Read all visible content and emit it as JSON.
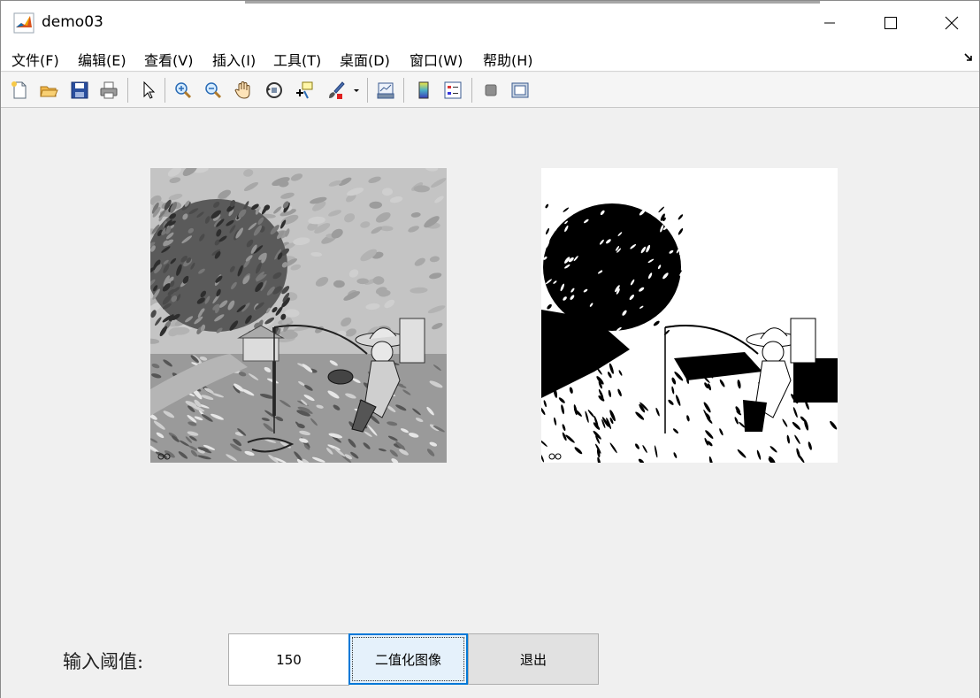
{
  "window": {
    "title": "demo03",
    "app_icon": "matlab-icon",
    "controls": [
      "minimize-icon",
      "maximize-icon",
      "close-icon"
    ]
  },
  "menu": {
    "items": [
      {
        "label": "文件(F)"
      },
      {
        "label": "编辑(E)"
      },
      {
        "label": "查看(V)"
      },
      {
        "label": "插入(I)"
      },
      {
        "label": "工具(T)"
      },
      {
        "label": "桌面(D)"
      },
      {
        "label": "窗口(W)"
      },
      {
        "label": "帮助(H)"
      }
    ],
    "dock_icon": "undock-arrow-icon"
  },
  "toolbar": {
    "buttons": [
      "new-figure-icon",
      "open-file-icon",
      "save-icon",
      "print-icon",
      "edit-plot-icon",
      "zoom-in-icon",
      "zoom-out-icon",
      "pan-icon",
      "rotate-3d-icon",
      "data-cursor-icon",
      "brush-icon",
      "link-plot-icon",
      "colorbar-icon",
      "legend-icon",
      "hide-plot-tools-icon",
      "show-plot-tools-icon"
    ]
  },
  "figure": {
    "left_axes": "grayscale-image",
    "right_axes": "binary-image"
  },
  "controls": {
    "threshold_label": "输入阈值:",
    "threshold_value": "150",
    "binarize_button": "二值化图像",
    "exit_button": "退出"
  },
  "colors": {
    "focus_border": "#0078d7",
    "focus_fill": "#e5f1fb",
    "figure_bg": "#f0f0f0"
  }
}
